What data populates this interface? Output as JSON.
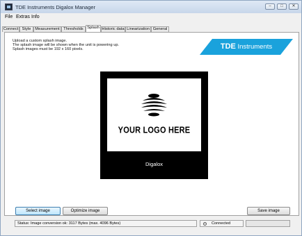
{
  "window": {
    "title": "TDE Instruments Digalox Manager"
  },
  "menu": [
    "File",
    "Extras",
    "Info"
  ],
  "tabs": [
    {
      "label": "Connect",
      "active": false
    },
    {
      "label": "Style",
      "active": false
    },
    {
      "label": "Measurement",
      "active": false
    },
    {
      "label": "Thresholds",
      "active": false
    },
    {
      "label": "Splash",
      "active": true
    },
    {
      "label": "Historic data",
      "active": false
    },
    {
      "label": "Linearization",
      "active": false
    },
    {
      "label": "General",
      "active": false
    }
  ],
  "splash_tab": {
    "info_lines": [
      "Upload a custom splash image.",
      "The splash image will be shown when the unit is powering up.",
      "Splash images must be 192 x 160 pixels."
    ],
    "brand": {
      "bold": "TDE",
      "rest": " Instruments",
      "color": "#1aa2dc"
    },
    "preview": {
      "logo_text": "YOUR LOGO HERE",
      "caption": "Digalox"
    },
    "buttons": {
      "select": "Select image",
      "optimize": "Optimize image",
      "save": "Save image"
    }
  },
  "status": {
    "text": "Status: Image conversion ok: 3117 Bytes (max. 4096 Bytes)",
    "connection": "Connected",
    "progress": 0
  }
}
